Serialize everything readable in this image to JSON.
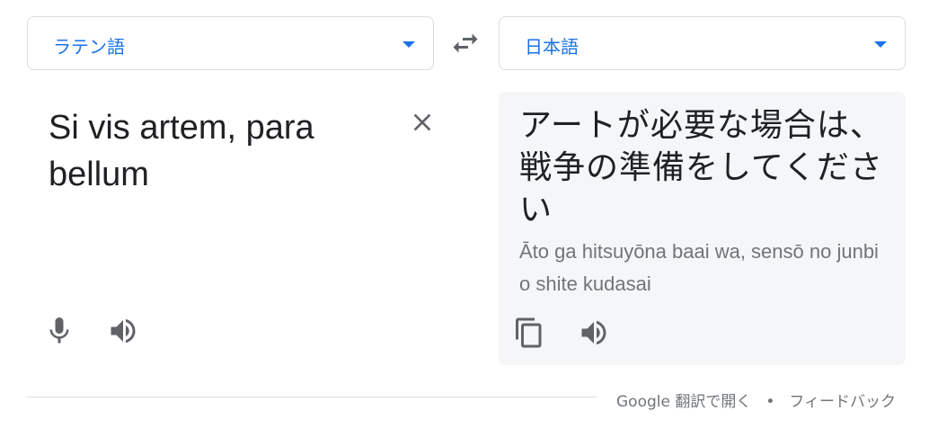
{
  "source_language": {
    "label": "ラテン語",
    "icon": "chevron-down-icon"
  },
  "target_language": {
    "label": "日本語",
    "icon": "chevron-down-icon"
  },
  "swap": {
    "icon": "swap-icon"
  },
  "source": {
    "text": "Si vis artem, para bellum",
    "clear_icon": "close-icon",
    "mic_icon": "microphone-icon",
    "speaker_icon": "speaker-icon"
  },
  "target": {
    "text": "アートが必要な場合は、戦争の準備をしてください",
    "romanization": "Āto ga hitsuyōna baai wa, sensō no junbi o shite kudasai",
    "copy_icon": "copy-icon",
    "speaker_icon": "speaker-icon"
  },
  "footer": {
    "open_in_translate": "Google 翻訳で開く",
    "separator": "•",
    "feedback": "フィードバック"
  },
  "colors": {
    "accent": "#1a73e8",
    "icon": "#5f6368",
    "muted_text": "#70757a",
    "panel_bg": "#f5f6f7",
    "border": "#dadce0"
  }
}
